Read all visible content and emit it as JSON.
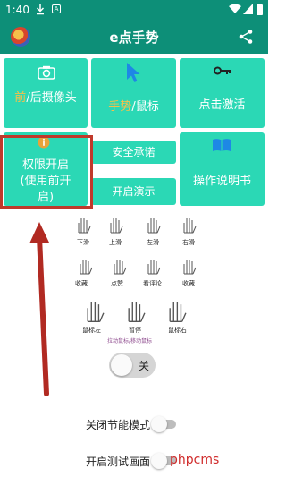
{
  "status": {
    "time": "1:40"
  },
  "app": {
    "title": "e点手势"
  },
  "tiles": {
    "camera": {
      "accent": "前",
      "rest": "/后摄像头"
    },
    "gesture_mouse": {
      "accent": "手势",
      "rest": "/鼠标"
    },
    "activate": {
      "label": "点击激活"
    },
    "permission": {
      "line1": "权限开启",
      "line2": "(使用前开",
      "line3": "启)"
    },
    "safety": {
      "label": "安全承诺"
    },
    "demo": {
      "label": "开启演示"
    },
    "manual": {
      "label": "操作说明书"
    }
  },
  "gestures": {
    "down": "下滑",
    "up": "上滑",
    "left": "左滑",
    "right": "右滑",
    "collect": "收藏",
    "like": "点赞",
    "comment": "看评论",
    "save": "收藏",
    "left_marker": "鼠标左",
    "pause": "暂停",
    "right_marker": "鼠标右",
    "caption": "拉动鼠标/移动鼠标"
  },
  "main_toggle": {
    "label": "关"
  },
  "settings": {
    "power_save": "关闭节能模式",
    "test_screen": "开启测试画面"
  },
  "watermark": "phpcms"
}
